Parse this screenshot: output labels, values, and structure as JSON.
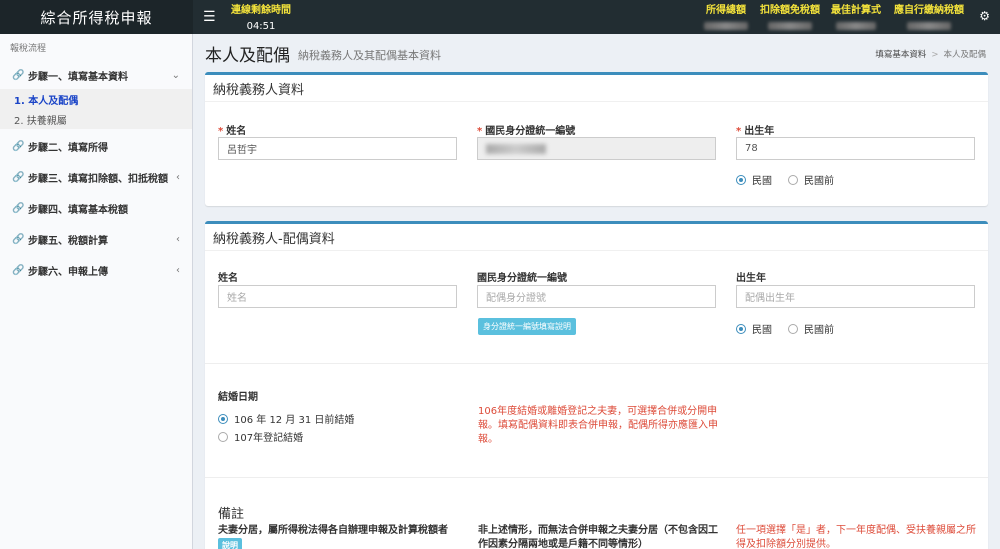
{
  "app": {
    "title": "綜合所得稅申報"
  },
  "session": {
    "label": "連線剩餘時間",
    "time": "04:51"
  },
  "summary": [
    {
      "label": "所得總額"
    },
    {
      "label": "扣除額免稅額"
    },
    {
      "label": "最佳計算式"
    },
    {
      "label": "應自行繳納稅額"
    }
  ],
  "sidebar": {
    "header": "報稅流程",
    "steps": [
      {
        "label": "步驟一、填寫基本資料",
        "chevron": "⌄"
      },
      {
        "label": "步驟二、填寫所得",
        "chevron": ""
      },
      {
        "label": "步驟三、填寫扣除額、扣抵稅額",
        "chevron": "‹"
      },
      {
        "label": "步驟四、填寫基本稅額",
        "chevron": ""
      },
      {
        "label": "步驟五、稅額計算",
        "chevron": "‹"
      },
      {
        "label": "步驟六、申報上傳",
        "chevron": "‹"
      }
    ],
    "sub_items": [
      {
        "label": "1. 本人及配偶"
      },
      {
        "label": "2. 扶養親屬"
      }
    ]
  },
  "page": {
    "title": "本人及配偶",
    "subtitle": "納稅義務人及其配偶基本資料",
    "breadcrumb": [
      "填寫基本資料",
      ">",
      "本人及配偶"
    ]
  },
  "taxpayer": {
    "title": "納稅義務人資料",
    "name_label": "姓名",
    "name_value": "呂哲宇",
    "id_label": "國民身分證統一編號",
    "birth_label": "出生年",
    "birth_value": "78",
    "era_roc": "民國",
    "era_pre_roc": "民國前"
  },
  "spouse": {
    "title": "納稅義務人-配偶資料",
    "name_label": "姓名",
    "name_placeholder": "姓名",
    "id_label": "國民身分證統一編號",
    "id_placeholder": "配偶身分證號",
    "id_help_button": "身分證統一編號填寫說明",
    "birth_label": "出生年",
    "birth_placeholder": "配偶出生年",
    "era_roc": "民國",
    "era_pre_roc": "民國前",
    "marriage_label": "結婚日期",
    "marriage_option1": "106 年 12 月 31 日前結婚",
    "marriage_option2": "107年登記結婚",
    "marriage_note": "106年度結婚或離婚登記之夫妻，可選擇合併或分開申報。填寫配偶資料即表合併申報，配偶所得亦應匯入申報。",
    "remarks_title": "備註",
    "remark1": "夫妻分居，屬所得稅法得各自辦理申報及計算稅額者",
    "remark1_button": "說明",
    "remark2": "非上述情形，而無法合併申報之夫妻分居（不包含因工作因素分隔兩地或是戶籍不同等情形）",
    "remark3": "任一項選擇「是」者，下一年度配偶、受扶養親屬之所得及扣除額分別提供。"
  },
  "colors": {
    "accent": "#3c8dbc",
    "topbar": "#222d32",
    "highlight": "#f5e43b",
    "warning": "#dd4b39"
  }
}
